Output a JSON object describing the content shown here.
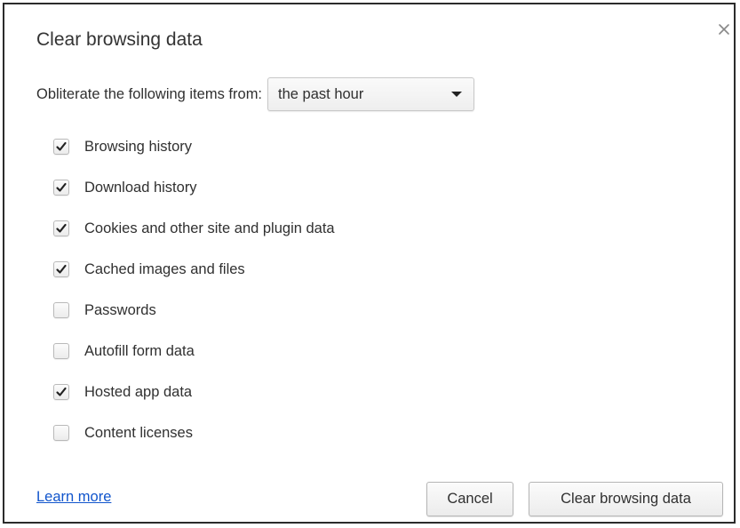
{
  "dialog": {
    "title": "Clear browsing data",
    "close_icon": "close-icon"
  },
  "time_range": {
    "label": "Obliterate the following items from:",
    "selected": "the past hour",
    "icon": "dropdown-arrow-icon"
  },
  "options": [
    {
      "label": "Browsing history",
      "checked": true
    },
    {
      "label": "Download history",
      "checked": true
    },
    {
      "label": "Cookies and other site and plugin data",
      "checked": true
    },
    {
      "label": "Cached images and files",
      "checked": true
    },
    {
      "label": "Passwords",
      "checked": false
    },
    {
      "label": "Autofill form data",
      "checked": false
    },
    {
      "label": "Hosted app data",
      "checked": true
    },
    {
      "label": "Content licenses",
      "checked": false
    }
  ],
  "footer": {
    "learn_more": "Learn more",
    "cancel": "Cancel",
    "clear": "Clear browsing data"
  },
  "colors": {
    "link": "#1155cc",
    "text": "#303030",
    "border": "#2b2b2b"
  }
}
